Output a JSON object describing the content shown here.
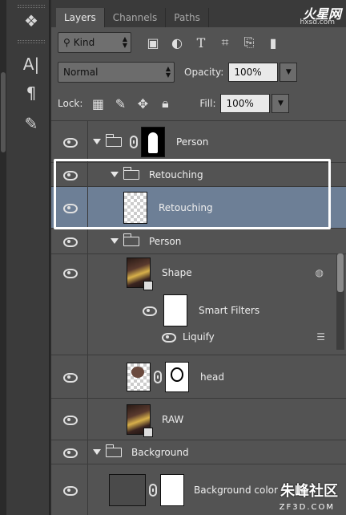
{
  "tabs": [
    {
      "label": "Layers",
      "active": true
    },
    {
      "label": "Channels",
      "active": false
    },
    {
      "label": "Paths",
      "active": false
    }
  ],
  "filter": {
    "kind_label": "Kind"
  },
  "blend": {
    "mode": "Normal",
    "opacity_label": "Opacity:",
    "opacity_value": "100%"
  },
  "lock": {
    "lock_label": "Lock:",
    "fill_label": "Fill:",
    "fill_value": "100%"
  },
  "tool_strip_icons": [
    "styles-icon",
    "character-icon",
    "paragraph-icon",
    "brushes-icon"
  ],
  "layers": [
    {
      "name": "Person",
      "type": "group-mask",
      "indent": 0
    },
    {
      "name": "Retouching",
      "type": "group",
      "indent": 1
    },
    {
      "name": "Retouching",
      "type": "layer",
      "indent": 2,
      "selected": true
    },
    {
      "name": "Person",
      "type": "group",
      "indent": 1
    },
    {
      "name": "Shape",
      "type": "smart-object",
      "indent": 2
    },
    {
      "name": "Smart Filters",
      "type": "filter-mask",
      "indent": 3
    },
    {
      "name": "Liquify",
      "type": "filter",
      "indent": 3
    },
    {
      "name": "head",
      "type": "layer-mask",
      "indent": 2
    },
    {
      "name": "RAW",
      "type": "smart-object",
      "indent": 2
    },
    {
      "name": "Background",
      "type": "group",
      "indent": 0
    },
    {
      "name": "Background color",
      "type": "layer-mask",
      "indent": 1
    }
  ],
  "watermarks": {
    "top": "火星网",
    "top_sub": "hxsd.com",
    "bottom": "朱峰社区",
    "bottom_sub": "ZF3D.COM"
  },
  "colors": {
    "panel_bg": "#535353",
    "selection": "#6d7f96",
    "highlight_border": "#ffffff"
  }
}
